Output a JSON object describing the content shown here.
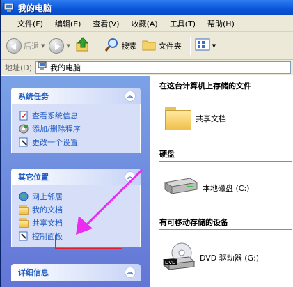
{
  "window": {
    "title": "我的电脑"
  },
  "menu": [
    {
      "label": "文件(F)"
    },
    {
      "label": "编辑(E)"
    },
    {
      "label": "查看(V)"
    },
    {
      "label": "收藏(A)"
    },
    {
      "label": "工具(T)"
    },
    {
      "label": "帮助(H)"
    }
  ],
  "toolbar": {
    "back_label": "后退",
    "search_label": "搜索",
    "folders_label": "文件夹"
  },
  "address": {
    "label": "地址(D)",
    "value": "我的电脑"
  },
  "tasks": {
    "system": {
      "title": "系统任务",
      "items": [
        {
          "label": "查看系统信息"
        },
        {
          "label": "添加/删除程序"
        },
        {
          "label": "更改一个设置"
        }
      ]
    },
    "other": {
      "title": "其它位置",
      "items": [
        {
          "label": "网上邻居"
        },
        {
          "label": "我的文档"
        },
        {
          "label": "共享文档"
        },
        {
          "label": "控制面板"
        }
      ]
    },
    "details": {
      "title": "详细信息"
    }
  },
  "content": {
    "files_section": {
      "title": "在这台计算机上存储的文件",
      "items": [
        {
          "label": "共享文档"
        }
      ]
    },
    "disk_section": {
      "title": "硬盘",
      "items": [
        {
          "label": "本地磁盘 (C:)"
        }
      ]
    },
    "removable_section": {
      "title": "有可移动存储的设备",
      "items": [
        {
          "label": "DVD 驱动器 (G:)"
        }
      ]
    }
  },
  "colors": {
    "highlight": "#e0202a",
    "arrow": "#e92cf0",
    "task_link": "#215dc6"
  }
}
